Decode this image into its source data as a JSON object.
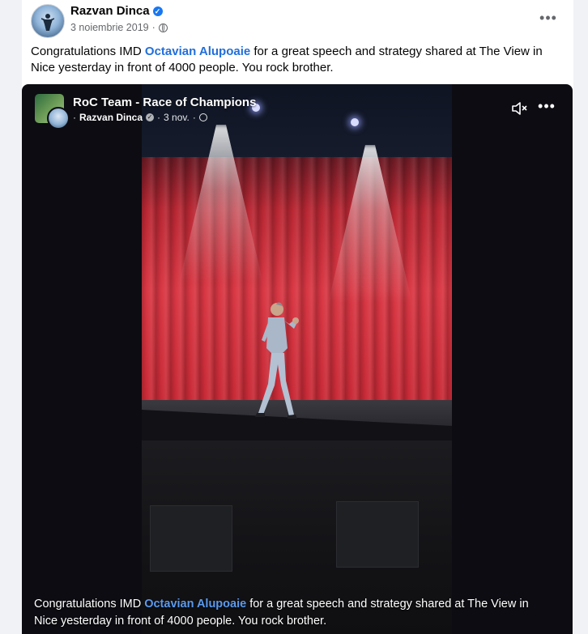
{
  "post": {
    "author_name": "Razvan Dinca",
    "date": "3 noiembrie 2019",
    "text_before": "Congratulations IMD ",
    "mention": "Octavian Alupoaie",
    "text_after": " for a great speech and strategy shared at The View in Nice yesterday in front of 4000 people. You rock brother.",
    "more_label": "•••"
  },
  "video": {
    "group_name": "RoC Team - Race of Champions",
    "posted_by": "Razvan Dinca",
    "date": "3 nov.",
    "separator": "·",
    "more_label": "•••",
    "caption_before": "Congratulations IMD ",
    "caption_mention": "Octavian Alupoaie",
    "caption_after": " for a great speech and strategy shared at The View in Nice yesterday in front of 4000 people. You rock brother.",
    "muted": true
  },
  "icons": {
    "verified": "verified-badge-icon",
    "audience": "globe-icon",
    "mute": "speaker-muted-icon",
    "more": "more-options-icon"
  },
  "colors": {
    "mention_link": "#216fdb",
    "verified": "#1877f2",
    "video_background": "#0c0c12"
  }
}
